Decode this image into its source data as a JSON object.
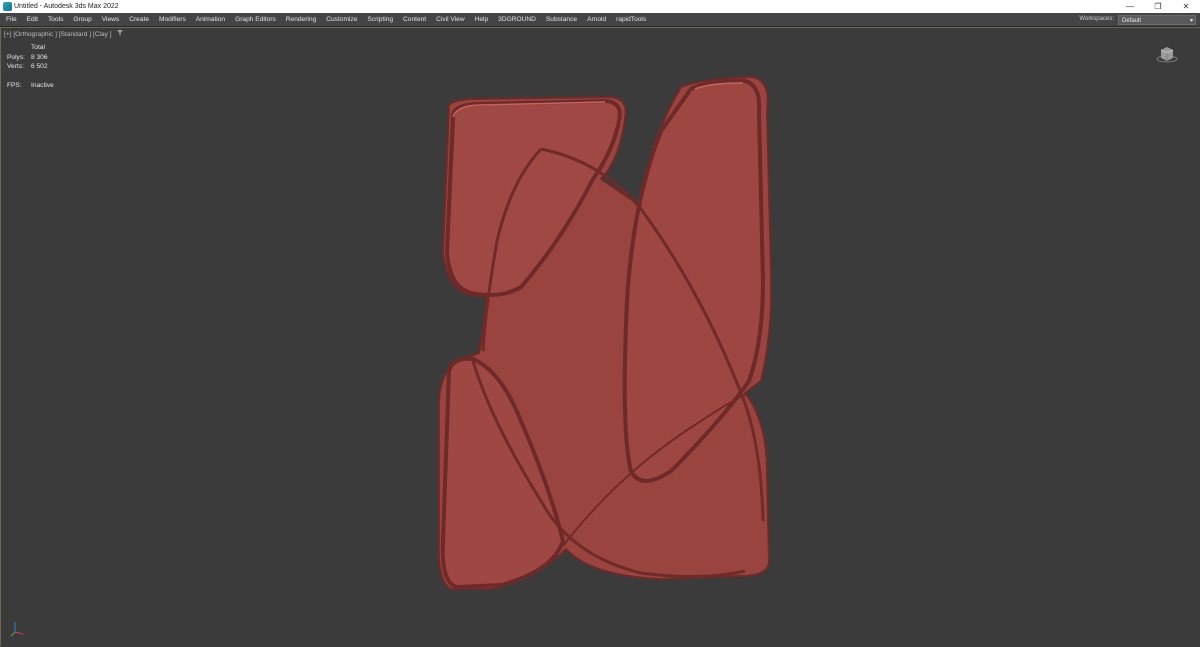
{
  "window": {
    "title": "Untitled - Autodesk 3ds Max 2022",
    "minimize_glyph": "—",
    "restore_glyph": "❐",
    "close_glyph": "✕"
  },
  "menu": {
    "items": [
      "File",
      "Edit",
      "Tools",
      "Group",
      "Views",
      "Create",
      "Modifiers",
      "Animation",
      "Graph Editors",
      "Rendering",
      "Customize",
      "Scripting",
      "Content",
      "Civil View",
      "Help",
      "3DGROUND",
      "Substance",
      "Arnold",
      "rapidTools"
    ]
  },
  "workspace": {
    "label": "Workspaces:",
    "value": "Default",
    "arrow": "▾"
  },
  "viewport": {
    "label": "[+] [Orthographic ] [Standard ] [Clay ]",
    "filter_icon": "filter-icon",
    "stats": {
      "header": "Total",
      "polys_label": "Polys:",
      "polys_value": "8 306",
      "verts_label": "Verts:",
      "verts_value": "6 502",
      "fps_label": "FPS:",
      "fps_value": "Inactive"
    },
    "model_color": "#9a4440",
    "model_edge_color": "#6e2a28",
    "background": "#3b3b3b"
  }
}
